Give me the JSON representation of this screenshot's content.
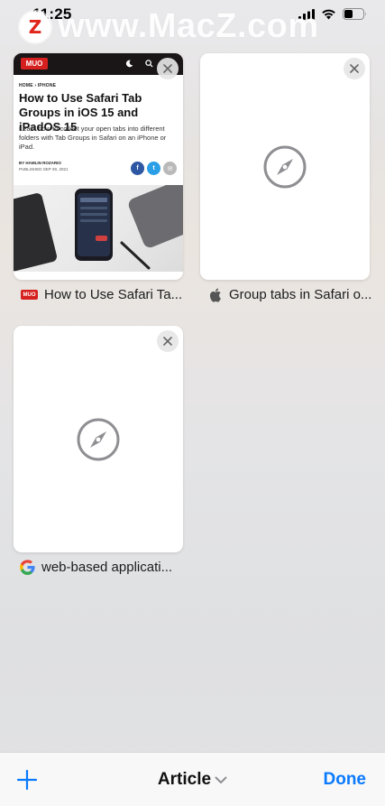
{
  "status_bar": {
    "time": "11:25"
  },
  "watermark": {
    "logo_letter": "Z",
    "text": "www.MacZ.com"
  },
  "tabs": [
    {
      "label": "How to Use Safari Ta...",
      "favicon_text": "MUO",
      "preview": {
        "logo": "MUO",
        "breadcrumb": "HOME  ›  IPHONE",
        "title": "How to Use Safari Tab Groups in iOS 15 and iPadOS 15",
        "description": "Learn how to collect your open tabs into different folders with Tab Groups in Safari on an iPhone or iPad.",
        "author": "BY HAMLIN ROZARIO",
        "date": "PUBLISHED SEP 29, 2021"
      }
    },
    {
      "label": "Group tabs in Safari o...",
      "favicon": "apple-icon"
    },
    {
      "label": "web-based applicati...",
      "favicon": "google-icon"
    }
  ],
  "toolbar": {
    "group_title": "Article",
    "done_label": "Done"
  },
  "colors": {
    "accent": "#0a7aff",
    "muo_red": "#d6201f"
  }
}
